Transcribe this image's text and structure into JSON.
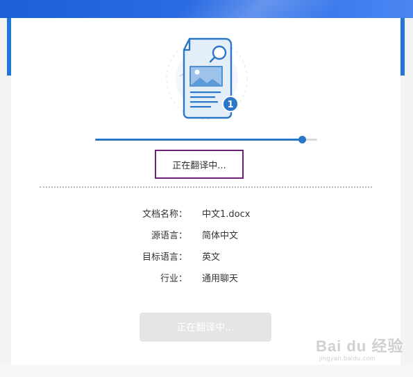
{
  "colors": {
    "accent_blue": "#2b77c7",
    "header_blue": "#1c5fd6",
    "highlight_border": "#6d1f78",
    "disabled_button": "#e5e5e5"
  },
  "illustration": {
    "badge_number": "1",
    "icons": [
      "document-icon",
      "magnifier-icon",
      "image-placeholder-icon"
    ]
  },
  "progress": {
    "value": 0.93
  },
  "status": {
    "text": "正在翻译中..."
  },
  "details": [
    {
      "label": "文档名称：",
      "value": "中文1.docx"
    },
    {
      "label": "源语言：",
      "value": "简体中文"
    },
    {
      "label": "目标语言：",
      "value": "英文"
    },
    {
      "label": "行业：",
      "value": "通用聊天"
    }
  ],
  "action_button": {
    "label": "正在翻译中..."
  },
  "watermark": {
    "main": "Bai du 经验",
    "sub": "jingyan.baidu.com"
  }
}
